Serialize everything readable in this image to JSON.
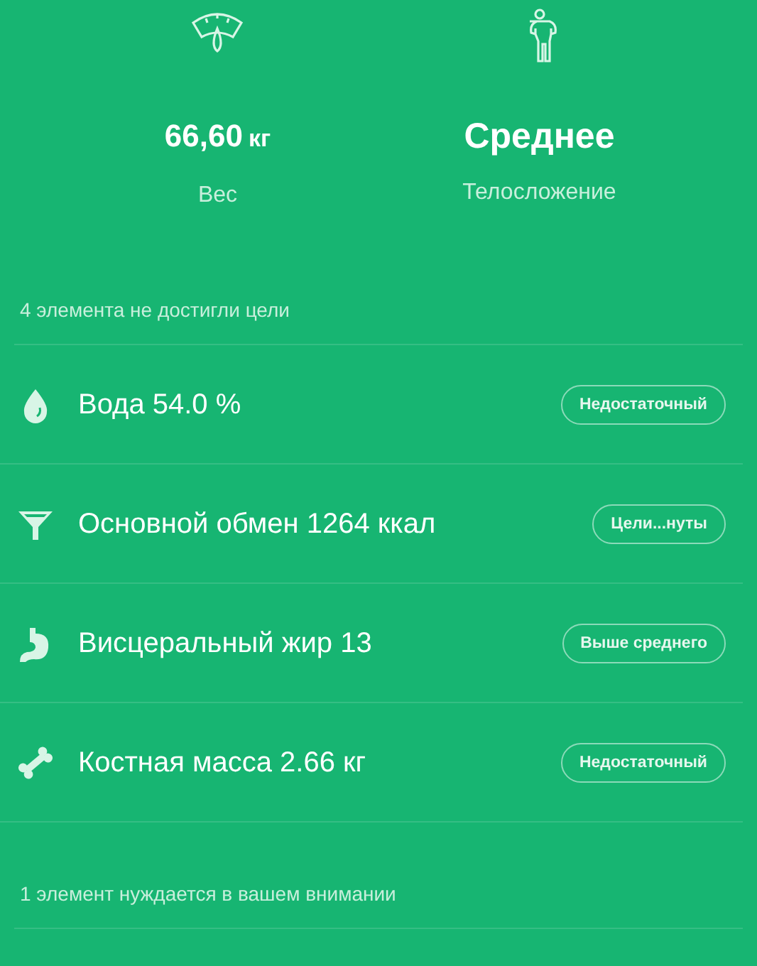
{
  "summary": [
    {
      "kind": "weight",
      "value": "66,60",
      "unit": "кг",
      "label": "Вес"
    },
    {
      "kind": "body",
      "value": "Среднее",
      "label": "Телосложение"
    }
  ],
  "sections": [
    {
      "header": "4 элемента не достигли цели",
      "items": [
        {
          "kind": "water",
          "text": "Вода 54.0 %",
          "status": "Недостаточный"
        },
        {
          "kind": "metabolism",
          "text": "Основной обмен 1264 ккал",
          "status": "Цели...нуты"
        },
        {
          "kind": "visceral",
          "text": "Висцеральный жир 13",
          "status": "Выше среднего"
        },
        {
          "kind": "bone",
          "text": "Костная масса 2.66 кг",
          "status": "Недостаточный"
        }
      ]
    },
    {
      "header": "1 элемент нуждается в вашем внимании"
    }
  ]
}
